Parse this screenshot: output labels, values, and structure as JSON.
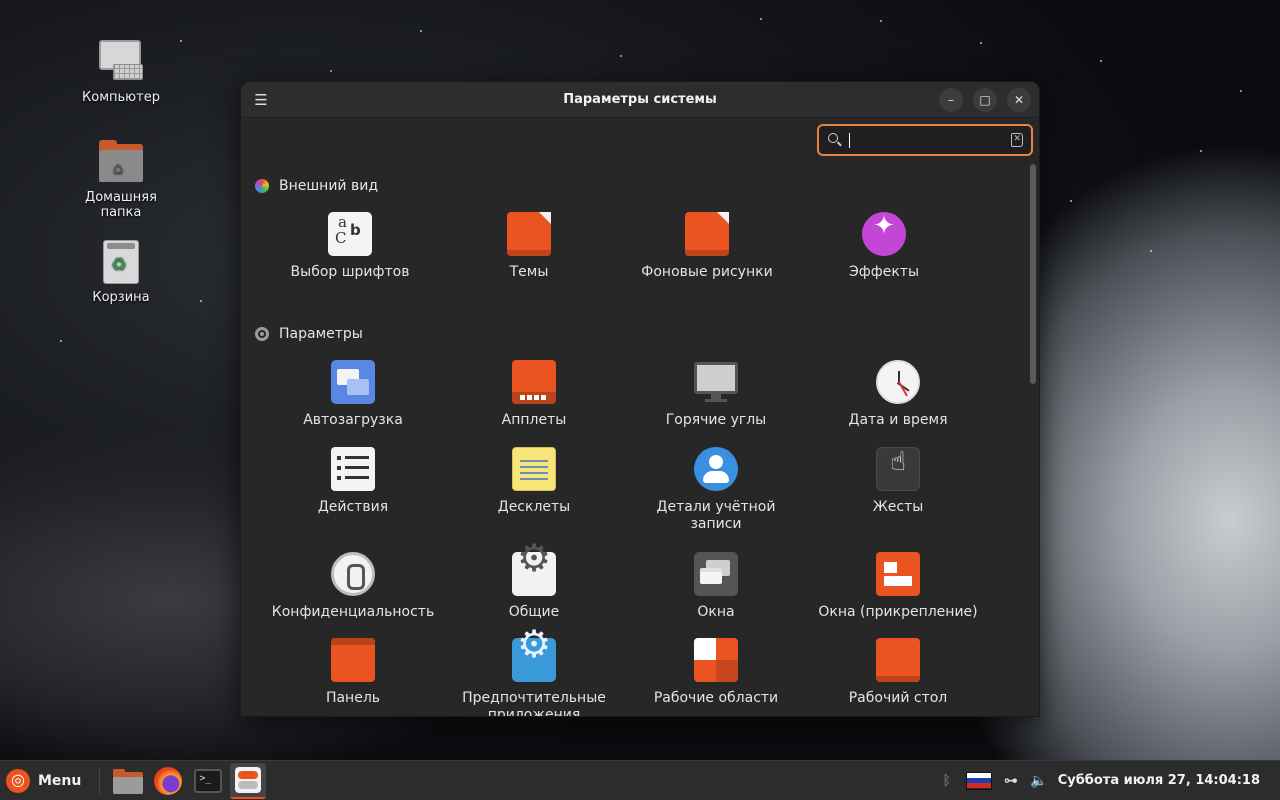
{
  "desktop": {
    "icons": [
      {
        "label": "Компьютер"
      },
      {
        "label": "Домашняя папка"
      },
      {
        "label": "Корзина"
      }
    ]
  },
  "window": {
    "title": "Параметры системы",
    "search": {
      "value": "",
      "placeholder": ""
    },
    "sections": [
      {
        "title": "Внешний вид",
        "items": [
          {
            "label": "Выбор шрифтов",
            "icon": "fonts-icon"
          },
          {
            "label": "Темы",
            "icon": "themes-icon"
          },
          {
            "label": "Фоновые рисунки",
            "icon": "backgrounds-icon"
          },
          {
            "label": "Эффекты",
            "icon": "effects-icon"
          }
        ]
      },
      {
        "title": "Параметры",
        "items": [
          {
            "label": "Автозагрузка",
            "icon": "startup-apps-icon"
          },
          {
            "label": "Апплеты",
            "icon": "applets-icon"
          },
          {
            "label": "Горячие углы",
            "icon": "hot-corners-icon"
          },
          {
            "label": "Дата и время",
            "icon": "clock-icon"
          },
          {
            "label": "Действия",
            "icon": "actions-icon"
          },
          {
            "label": "Десклеты",
            "icon": "desklets-icon"
          },
          {
            "label": "Детали учётной записи",
            "icon": "account-icon"
          },
          {
            "label": "Жесты",
            "icon": "gestures-icon"
          },
          {
            "label": "Конфиденциальность",
            "icon": "privacy-icon"
          },
          {
            "label": "Общие",
            "icon": "general-icon"
          },
          {
            "label": "Окна",
            "icon": "windows-icon"
          },
          {
            "label": "Окна (прикрепление)",
            "icon": "window-tiling-icon"
          },
          {
            "label": "Панель",
            "icon": "panel-icon"
          },
          {
            "label": "Предпочтительные приложения",
            "icon": "preferred-apps-icon"
          },
          {
            "label": "Рабочие области",
            "icon": "workspaces-icon"
          },
          {
            "label": "Рабочий стол",
            "icon": "desktop-icon"
          }
        ]
      }
    ]
  },
  "taskbar": {
    "menu_label": "Menu",
    "clock": "Суббота июля 27, 14:04:18",
    "apps": [
      "files-icon",
      "firefox-icon",
      "terminal-icon",
      "settings-icon"
    ],
    "accent": "#e95420"
  }
}
